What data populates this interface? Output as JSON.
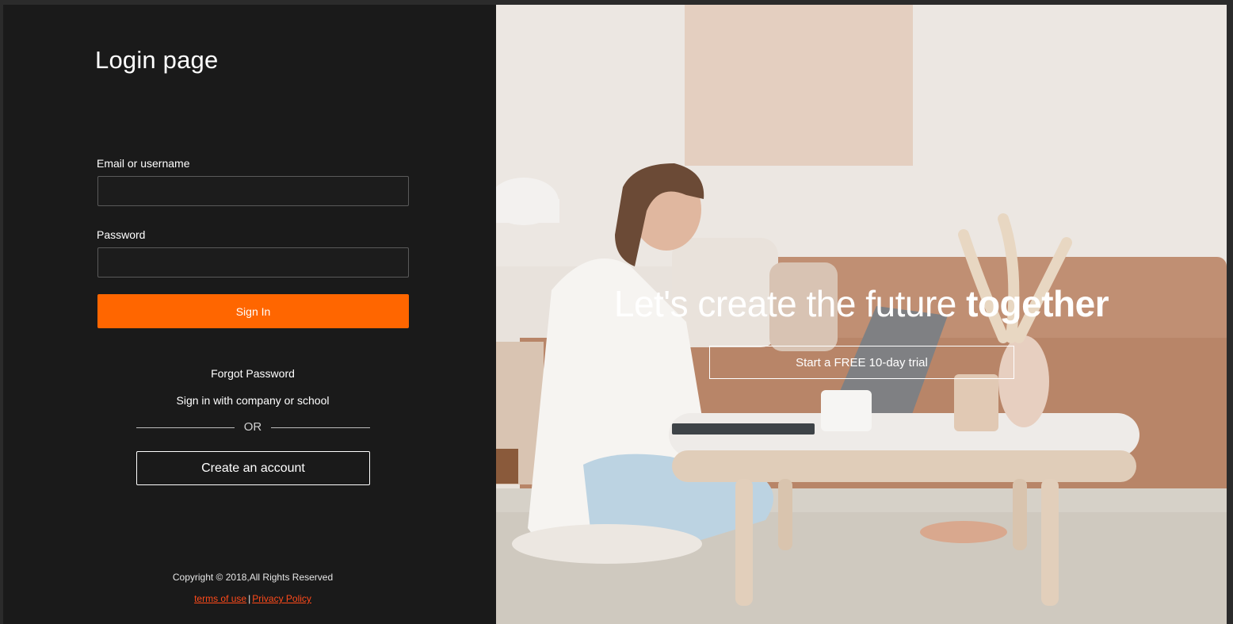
{
  "login": {
    "title": "Login page",
    "email_label": "Email or username",
    "email_value": "",
    "password_label": "Password",
    "password_value": "",
    "signin_label": "Sign In",
    "forgot_label": "Forgot Password",
    "company_label": "Sign in with company or school",
    "or_label": "OR",
    "create_label": "Create an account",
    "copyright": "Copyright © 2018,All Rights Reserved",
    "terms_label": "terms of use",
    "separator": "|",
    "privacy_label": "Privacy Policy"
  },
  "hero": {
    "heading_light": "Let's create the future",
    "heading_bold": "together",
    "trial_label": "Start a FREE 10-day trial"
  },
  "colors": {
    "accent": "#ff6600",
    "link": "#ff4a1a",
    "panel_bg": "#1a1a1a"
  }
}
